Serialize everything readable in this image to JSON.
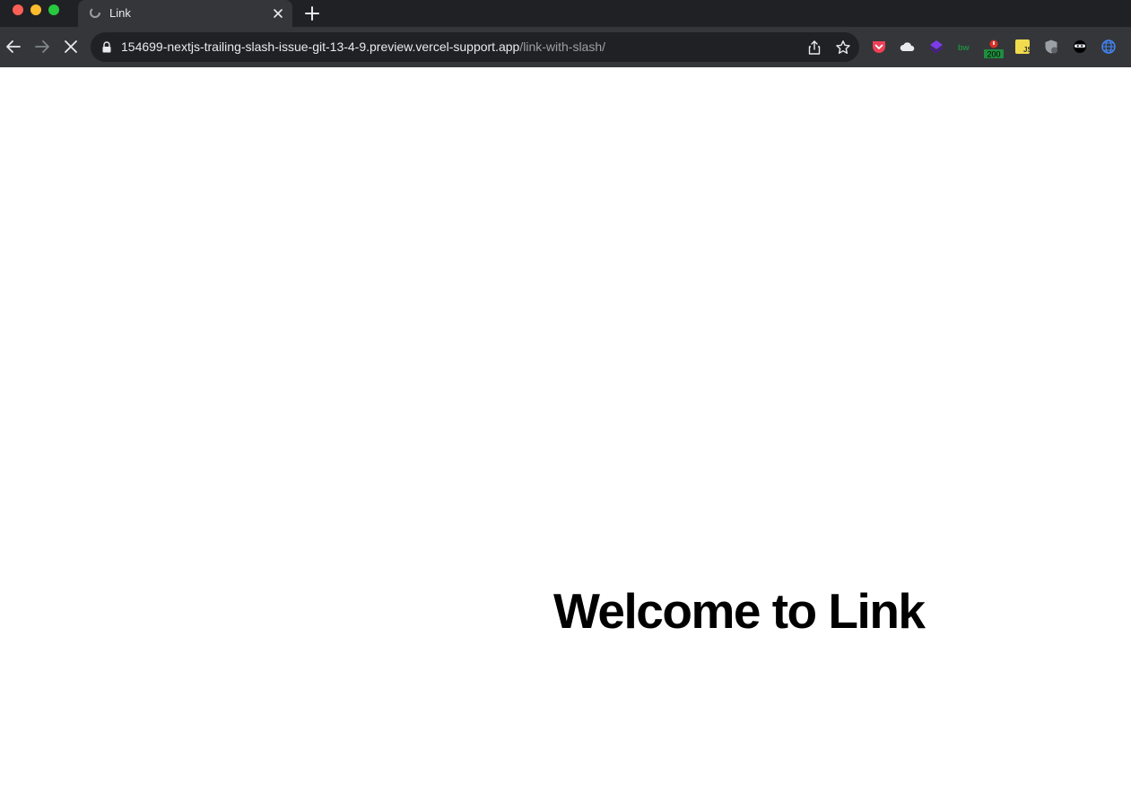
{
  "window": {
    "tab": {
      "title": "Link",
      "favicon": "vercel-spinner-icon"
    },
    "new_tab_label": "+"
  },
  "toolbar": {
    "url_host": "154699-nextjs-trailing-slash-issue-git-13-4-9.preview.vercel-support.app",
    "url_path": "/link-with-slash/",
    "extensions": [
      {
        "name": "pocket-icon",
        "color": "#ef4056"
      },
      {
        "name": "cloud-icon",
        "color": "#e8eaed"
      },
      {
        "name": "layers-icon",
        "color": "#5b2bd6"
      },
      {
        "name": "bw-icon",
        "label": "bw",
        "color": "#1e8e3e"
      },
      {
        "name": "status-200-icon",
        "badge": "200",
        "color": "#1e8e3e"
      },
      {
        "name": "js-icon",
        "label": "JS",
        "color": "#f0db4f"
      },
      {
        "name": "shield-icon",
        "color": "#9aa0a6"
      },
      {
        "name": "ninja-icon",
        "color": "#000000"
      },
      {
        "name": "globe-icon",
        "color": "#4285f4"
      }
    ]
  },
  "page": {
    "heading": "Welcome to Link"
  }
}
